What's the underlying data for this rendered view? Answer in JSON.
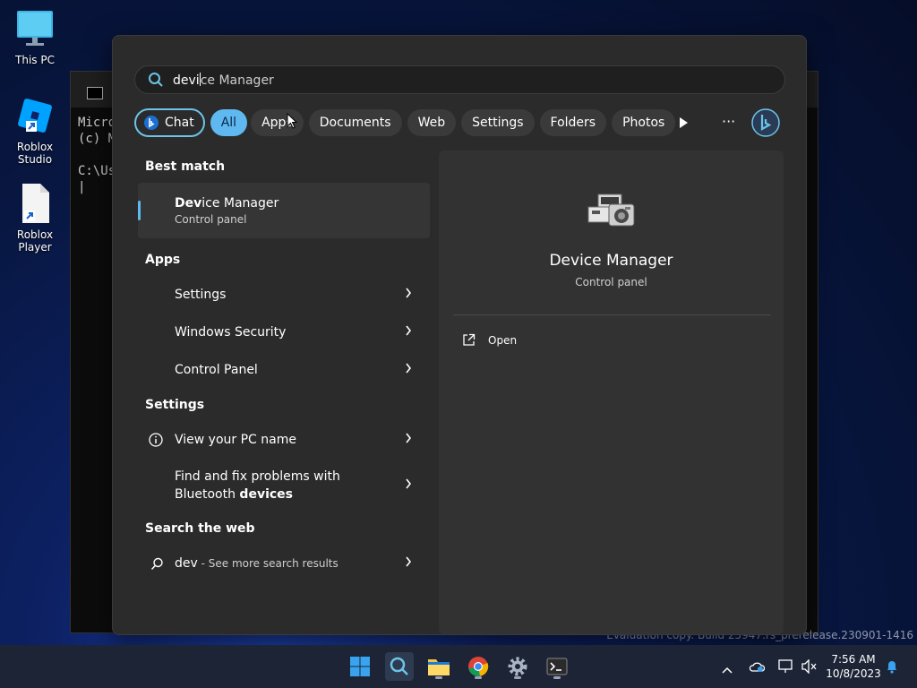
{
  "desktop": {
    "icons": [
      {
        "label": "This PC"
      },
      {
        "label": "Roblox Studio"
      },
      {
        "label": "Roblox Player"
      }
    ]
  },
  "cmd": {
    "lines": [
      "Micro",
      "(c) M",
      "",
      "C:\\Us",
      "|"
    ]
  },
  "search": {
    "query_typed": "devi",
    "query_suggest": "ce Manager",
    "chips": [
      {
        "label": "Chat",
        "kind": "chat"
      },
      {
        "label": "All",
        "kind": "active"
      },
      {
        "label": "Apps"
      },
      {
        "label": "Documents"
      },
      {
        "label": "Web"
      },
      {
        "label": "Settings"
      },
      {
        "label": "Folders"
      },
      {
        "label": "Photos"
      }
    ],
    "best_match": {
      "heading": "Best match",
      "title_bold": "Dev",
      "title_rest": "ice Manager",
      "subtitle": "Control panel"
    },
    "apps": {
      "heading": "Apps",
      "items": [
        "Settings",
        "Windows Security",
        "Control Panel"
      ]
    },
    "settings": {
      "heading": "Settings",
      "items": [
        {
          "label": "View your PC name"
        },
        {
          "line1": "Find and fix problems with",
          "line2_pre": "Bluetooth ",
          "line2_bold": "devices"
        }
      ]
    },
    "web": {
      "heading": "Search the web",
      "query": "dev",
      "suffix": " - See more search results"
    },
    "preview": {
      "title": "Device Manager",
      "subtitle": "Control panel",
      "action": "Open"
    }
  },
  "watermark": "Evaluation copy. Build 25947.rs_prerelease.230901-1416",
  "taskbar": {
    "time": "7:56 AM",
    "date": "10/8/2023"
  },
  "colors": {
    "accent": "#60b8f0",
    "panel": "#2b2b2b",
    "taskbar": "#1c2436"
  }
}
